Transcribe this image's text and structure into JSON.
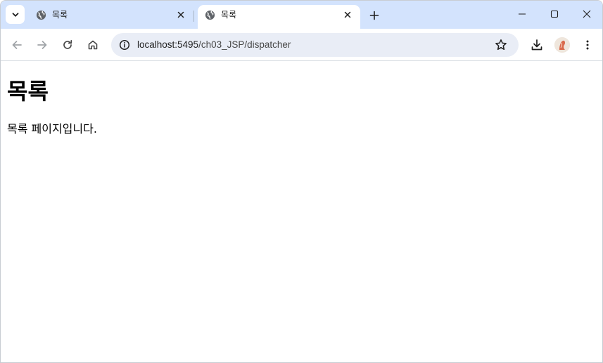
{
  "tabs": [
    {
      "title": "목록",
      "active": false
    },
    {
      "title": "목록",
      "active": true
    }
  ],
  "icons": {
    "tab_search": "chevron-down-icon",
    "favicon": "globe-icon",
    "tab_close": "close-icon",
    "new_tab": "plus-icon",
    "minimize": "minimize-icon",
    "maximize": "maximize-icon",
    "window_close": "close-icon",
    "back": "arrow-left-icon",
    "forward": "arrow-right-icon",
    "reload": "reload-icon",
    "home": "home-icon",
    "site_info": "info-icon",
    "bookmark": "star-icon",
    "download": "download-icon",
    "menu": "kebab-menu-icon"
  },
  "address_bar": {
    "host": "localhost:5495",
    "path": "/ch03_JSP/dispatcher"
  },
  "page": {
    "heading": "목록",
    "body_text": "목록 페이지입니다."
  },
  "colors": {
    "tabstrip_bg": "#d3e3fd",
    "omnibox_bg": "#e9edf6",
    "icon": "#474747"
  }
}
